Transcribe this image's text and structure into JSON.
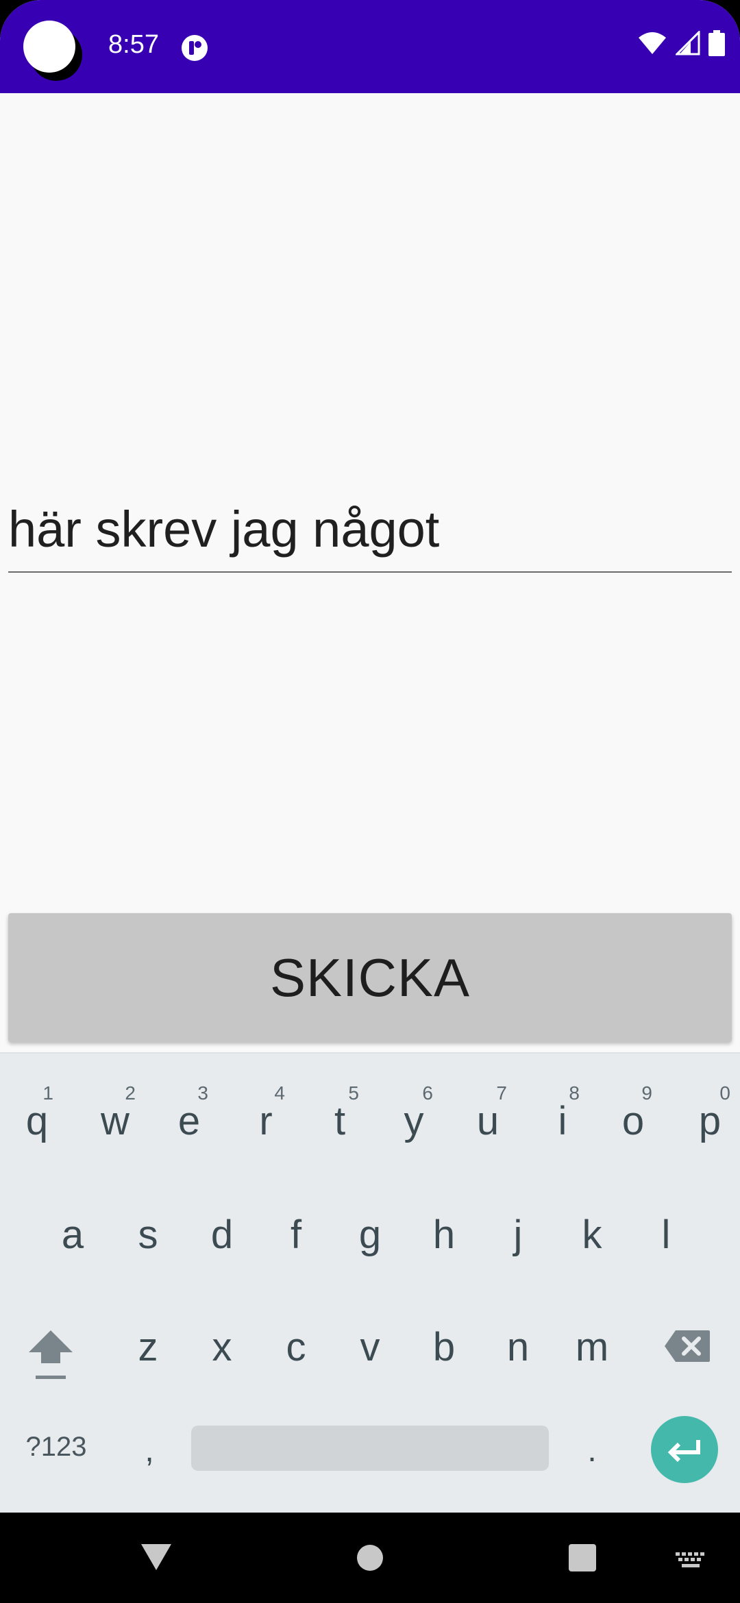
{
  "status_bar": {
    "time": "8:57",
    "background": "#3700b3"
  },
  "text_field": {
    "value": "här skrev jag något"
  },
  "send_button": {
    "label": "SKICKA"
  },
  "keyboard": {
    "row1": [
      {
        "letter": "q",
        "num": "1"
      },
      {
        "letter": "w",
        "num": "2"
      },
      {
        "letter": "e",
        "num": "3"
      },
      {
        "letter": "r",
        "num": "4"
      },
      {
        "letter": "t",
        "num": "5"
      },
      {
        "letter": "y",
        "num": "6"
      },
      {
        "letter": "u",
        "num": "7"
      },
      {
        "letter": "i",
        "num": "8"
      },
      {
        "letter": "o",
        "num": "9"
      },
      {
        "letter": "p",
        "num": "0"
      }
    ],
    "row2": [
      "a",
      "s",
      "d",
      "f",
      "g",
      "h",
      "j",
      "k",
      "l"
    ],
    "row3": [
      "z",
      "x",
      "c",
      "v",
      "b",
      "n",
      "m"
    ],
    "symbols_label": "?123",
    "comma": ",",
    "period": ".",
    "enter_color": "#45b8ac"
  },
  "icons": [
    "shift-icon",
    "backspace-icon",
    "enter-icon",
    "back-icon",
    "home-icon",
    "recents-icon",
    "keyboard-switch-icon",
    "wifi-icon",
    "signal-icon",
    "battery-icon"
  ]
}
